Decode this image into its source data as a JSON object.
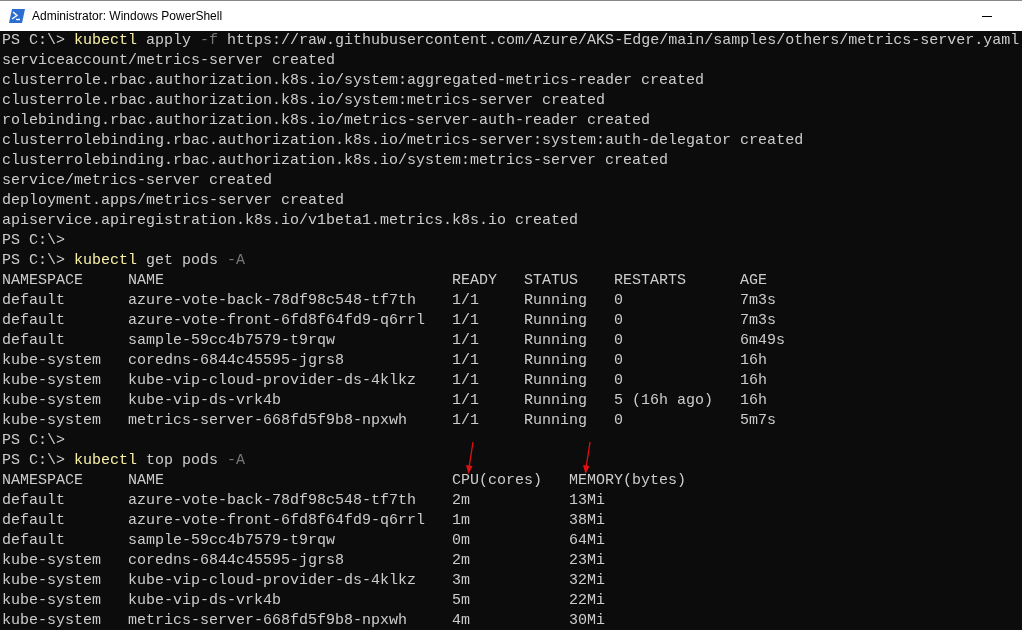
{
  "window": {
    "title": "Administrator: Windows PowerShell"
  },
  "lines": [
    {
      "kind": "prompt",
      "prompt": "PS C:\\>",
      "tokens": [
        {
          "kind": "command",
          "text": "kubectl"
        },
        {
          "kind": "argument",
          "text": "apply"
        },
        {
          "kind": "parameter",
          "text": "-f"
        },
        {
          "kind": "argument",
          "text": "https://raw.githubusercontent.com/Azure/AKS-Edge/main/samples/others/metrics-server.yaml"
        }
      ]
    },
    {
      "kind": "output",
      "text": "serviceaccount/metrics-server created"
    },
    {
      "kind": "output",
      "text": "clusterrole.rbac.authorization.k8s.io/system:aggregated-metrics-reader created"
    },
    {
      "kind": "output",
      "text": "clusterrole.rbac.authorization.k8s.io/system:metrics-server created"
    },
    {
      "kind": "output",
      "text": "rolebinding.rbac.authorization.k8s.io/metrics-server-auth-reader created"
    },
    {
      "kind": "output",
      "text": "clusterrolebinding.rbac.authorization.k8s.io/metrics-server:system:auth-delegator created"
    },
    {
      "kind": "output",
      "text": "clusterrolebinding.rbac.authorization.k8s.io/system:metrics-server created"
    },
    {
      "kind": "output",
      "text": "service/metrics-server created"
    },
    {
      "kind": "output",
      "text": "deployment.apps/metrics-server created"
    },
    {
      "kind": "output",
      "text": "apiservice.apiregistration.k8s.io/v1beta1.metrics.k8s.io created"
    },
    {
      "kind": "prompt",
      "prompt": "PS C:\\>"
    },
    {
      "kind": "prompt",
      "prompt": "PS C:\\>",
      "tokens": [
        {
          "kind": "command",
          "text": "kubectl"
        },
        {
          "kind": "argument",
          "text": "get"
        },
        {
          "kind": "argument",
          "text": "pods"
        },
        {
          "kind": "parameter",
          "text": "-A"
        }
      ]
    },
    {
      "kind": "table",
      "columns": [
        {
          "label": "NAMESPACE",
          "annotated": false
        },
        {
          "label": "NAME",
          "annotated": false
        },
        {
          "label": "READY",
          "annotated": false
        },
        {
          "label": "STATUS",
          "annotated": false
        },
        {
          "label": "RESTARTS",
          "annotated": false
        },
        {
          "label": "AGE",
          "annotated": false
        }
      ],
      "rows": [
        [
          "default",
          "azure-vote-back-78df98c548-tf7th",
          "1/1",
          "Running",
          "0",
          "7m3s"
        ],
        [
          "default",
          "azure-vote-front-6fd8f64fd9-q6rrl",
          "1/1",
          "Running",
          "0",
          "7m3s"
        ],
        [
          "default",
          "sample-59cc4b7579-t9rqw",
          "1/1",
          "Running",
          "0",
          "6m49s"
        ],
        [
          "kube-system",
          "coredns-6844c45595-jgrs8",
          "1/1",
          "Running",
          "0",
          "16h"
        ],
        [
          "kube-system",
          "kube-vip-cloud-provider-ds-4klkz",
          "1/1",
          "Running",
          "0",
          "16h"
        ],
        [
          "kube-system",
          "kube-vip-ds-vrk4b",
          "1/1",
          "Running",
          "5 (16h ago)",
          "16h"
        ],
        [
          "kube-system",
          "metrics-server-668fd5f9b8-npxwh",
          "1/1",
          "Running",
          "0",
          "5m7s"
        ]
      ]
    },
    {
      "kind": "prompt",
      "prompt": "PS C:\\>"
    },
    {
      "kind": "prompt",
      "prompt": "PS C:\\>",
      "tokens": [
        {
          "kind": "command",
          "text": "kubectl"
        },
        {
          "kind": "argument",
          "text": "top"
        },
        {
          "kind": "argument",
          "text": "pods"
        },
        {
          "kind": "parameter",
          "text": "-A"
        }
      ]
    },
    {
      "kind": "table",
      "columns": [
        {
          "label": "NAMESPACE",
          "annotated": false
        },
        {
          "label": "NAME",
          "annotated": false
        },
        {
          "label": "CPU(cores)",
          "annotated": true
        },
        {
          "label": "MEMORY(bytes)",
          "annotated": true
        }
      ],
      "rows": [
        [
          "default",
          "azure-vote-back-78df98c548-tf7th",
          "2m",
          "13Mi"
        ],
        [
          "default",
          "azure-vote-front-6fd8f64fd9-q6rrl",
          "1m",
          "38Mi"
        ],
        [
          "default",
          "sample-59cc4b7579-t9rqw",
          "0m",
          "64Mi"
        ],
        [
          "kube-system",
          "coredns-6844c45595-jgrs8",
          "2m",
          "23Mi"
        ],
        [
          "kube-system",
          "kube-vip-cloud-provider-ds-4klkz",
          "3m",
          "32Mi"
        ],
        [
          "kube-system",
          "kube-vip-ds-vrk4b",
          "5m",
          "22Mi"
        ],
        [
          "kube-system",
          "metrics-server-668fd5f9b8-npxwh",
          "4m",
          "30Mi"
        ]
      ]
    }
  ]
}
